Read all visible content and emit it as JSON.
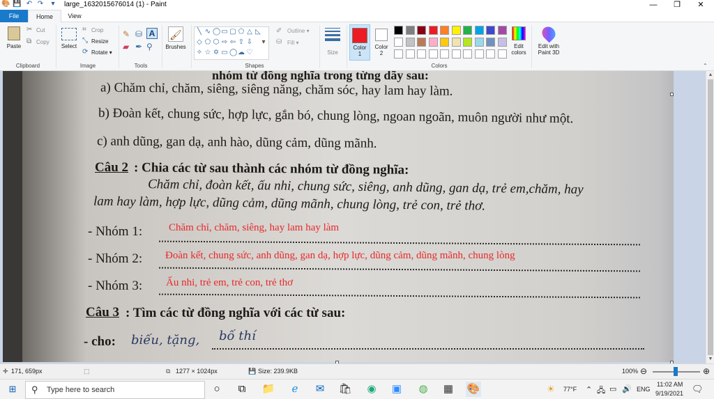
{
  "titlebar": {
    "title": "large_1632015676014 (1) - Paint",
    "minimize": "—",
    "maximize": "❐",
    "close": "✕"
  },
  "tabs": {
    "file": "File",
    "home": "Home",
    "view": "View"
  },
  "ribbon": {
    "clipboard": {
      "paste": "Paste",
      "cut": "Cut",
      "copy": "Copy",
      "group": "Clipboard"
    },
    "image": {
      "select": "Select",
      "crop": "Crop",
      "resize": "Resize",
      "rotate": "Rotate ▾",
      "group": "Image"
    },
    "tools": {
      "group": "Tools",
      "text_icon": "A"
    },
    "brushes": {
      "label": "Brushes"
    },
    "shapes": {
      "group": "Shapes",
      "outline": "Outline ▾",
      "fill": "Fill ▾"
    },
    "size": {
      "label": "Size"
    },
    "colors": {
      "color1_label": "Color\n1",
      "color2_label": "Color\n2",
      "group": "Colors",
      "edit_colors": "Edit\ncolors",
      "edit_paint3d": "Edit with\nPaint 3D",
      "color1": "#ed1c24",
      "color2": "#ffffff",
      "palette_row1": [
        "#000000",
        "#7f7f7f",
        "#880015",
        "#ed1c24",
        "#ff7f27",
        "#fff200",
        "#22b14c",
        "#00a2e8",
        "#3f48cc",
        "#a349a4"
      ],
      "palette_row2": [
        "#ffffff",
        "#c3c3c3",
        "#b97a57",
        "#ffaec9",
        "#ffc90e",
        "#efe4b0",
        "#b5e61d",
        "#99d9ea",
        "#7092be",
        "#c8bfe7"
      ],
      "palette_row3": [
        "#ffffff",
        "#ffffff",
        "#ffffff",
        "#ffffff",
        "#ffffff",
        "#ffffff",
        "#ffffff",
        "#ffffff",
        "#ffffff",
        "#ffffff"
      ]
    }
  },
  "document": {
    "line_top": "nhóm từ đồng nghĩa trong từng dãy sau:",
    "line_a": "a) Chăm chỉ, chăm, siêng, siêng năng, chăm sóc, hay lam hay làm.",
    "line_b": "b) Đoàn kết, chung sức, hợp lực, gắn bó, chung lòng, ngoan ngoãn, muôn người như một.",
    "line_c": "c) anh dũng, gan dạ, anh hào, dũng cảm, dũng mãnh.",
    "cau2_label": "Câu 2",
    "cau2_text": ": Chia các từ sau thành các nhóm từ đồng nghĩa:",
    "words_1": "Chăm chỉ, đoàn kết, ấu nhi, chung sức, siêng, anh dũng, gan dạ, trẻ em,chăm, hay",
    "words_2": "lam hay làm, hợp lực, dũng cảm, dũng mãnh, chung lòng, trẻ con, trẻ thơ.",
    "nhom1": "- Nhóm 1:",
    "nhom2": "- Nhóm 2:",
    "nhom3": "- Nhóm 3:",
    "ans1": "Chăm chỉ, chăm, siêng, hay lam hay làm",
    "ans2": "Đoàn kết, chung sức, anh dũng, gan dạ, hợp lực, dũng cảm, dũng mãnh, chung lòng",
    "ans3": "Ấu nhi, trẻ em, trẻ con, trẻ thơ",
    "cau3_label": "Câu 3",
    "cau3_text": ": Tìm các từ đồng nghĩa với các từ sau:",
    "cho": "- cho:",
    "hand1": "biếu, tặng,",
    "hand2": "bố thí"
  },
  "statusbar": {
    "cursor": "171, 659px",
    "dimensions": "1277 × 1024px",
    "size": "Size: 239.9KB",
    "zoom": "100%",
    "zoom_out": "⊖",
    "zoom_in": "⊕"
  },
  "taskbar": {
    "search_placeholder": "Type here to search",
    "weather": "77°F",
    "lang": "ENG",
    "time": "11:02 AM",
    "date": "9/19/2021"
  }
}
